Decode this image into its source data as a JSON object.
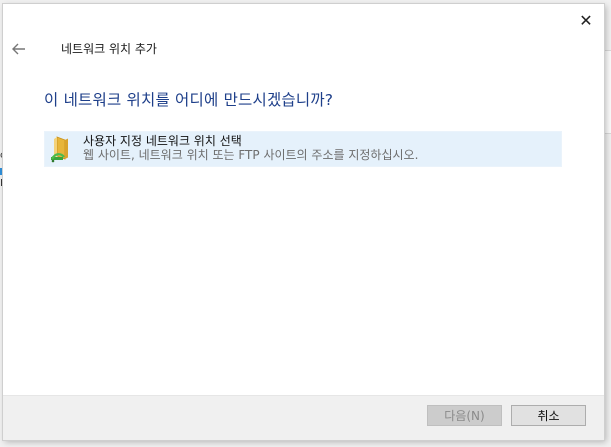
{
  "dialog": {
    "title": "네트워크 위치 추가",
    "close_glyph": "✕",
    "question": "이 네트워크 위치를 어디에 만드시겠습니까?",
    "option": {
      "title": "사용자 지정 네트워크 위치 선택",
      "description": "웹 사이트, 네트워크 위치 또는 FTP 사이트의 주소를 지정하십시오.",
      "icon": "network-folder-icon",
      "selected": true
    },
    "buttons": {
      "next_label": "다음(N)",
      "cancel_label": "취소"
    }
  },
  "background": {
    "left_sliver_text": "c",
    "left_sliver_text2": "E"
  },
  "colors": {
    "question_text": "#1e3f8a",
    "option_highlight": "#e5f1fb",
    "footer_bg": "#f0f0f0"
  }
}
